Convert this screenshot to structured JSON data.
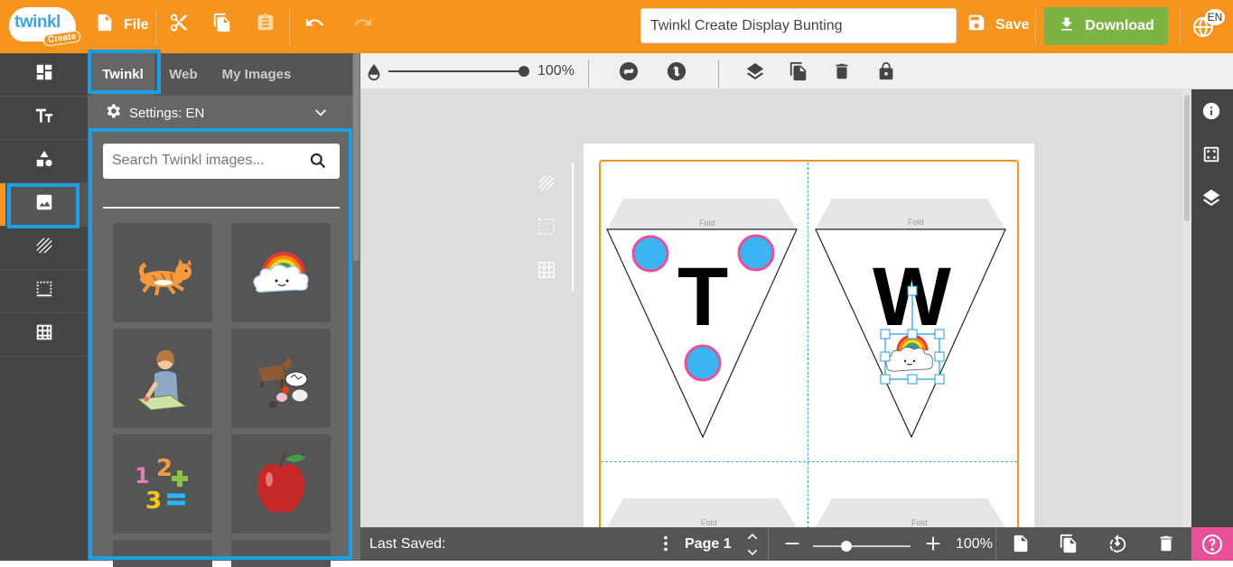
{
  "app": {
    "logo_word": "twinkl",
    "logo_tag": "Create",
    "file_label": "File",
    "document_title": "Twinkl Create Display Bunting",
    "save_label": "Save",
    "download_label": "Download",
    "language_code": "EN",
    "accent_color": "#f7941d",
    "download_color": "#7cb342",
    "highlight_color": "#1a9fe5"
  },
  "left_rail": {
    "items": [
      {
        "icon": "templates-icon"
      },
      {
        "icon": "text-icon"
      },
      {
        "icon": "shapes-icon"
      },
      {
        "icon": "images-icon",
        "active": true
      },
      {
        "icon": "backgrounds-icon"
      },
      {
        "icon": "borders-icon"
      },
      {
        "icon": "grid-icon"
      }
    ]
  },
  "image_panel": {
    "tabs": [
      {
        "label": "Twinkl",
        "active": true
      },
      {
        "label": "Web"
      },
      {
        "label": "My Images"
      }
    ],
    "settings_label": "Settings: EN",
    "search_placeholder": "Search Twinkl images...",
    "thumbnails": [
      "cat",
      "rainbow-cloud",
      "girl-painting",
      "farm-animals",
      "numbers",
      "apple"
    ]
  },
  "canvas_toolbar": {
    "opacity_percent": "100%",
    "opacity_value": 1.0
  },
  "canvas": {
    "pennants": [
      {
        "fold_label": "Fold",
        "letter": "T"
      },
      {
        "fold_label": "Fold",
        "letter": "W"
      },
      {
        "fold_label": "Fold"
      },
      {
        "fold_label": "Fold"
      }
    ]
  },
  "bottom_bar": {
    "last_saved_label": "Last Saved:",
    "page_label": "Page 1",
    "zoom_percent": "100%",
    "zoom_value": 0.35
  }
}
